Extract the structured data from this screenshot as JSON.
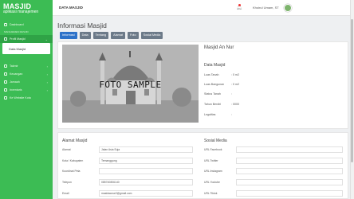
{
  "brand": {
    "logo_text": "MASJID",
    "subtitle": "aplikasi manajemen"
  },
  "sidebar": {
    "dashboard": "Dashboard",
    "section_label": "MANAJEMEN MASJID",
    "profil_label": "Profil Masjid",
    "sub_item": "Data Masjid",
    "items": [
      "Takmir",
      "Keuangan",
      "Jamaah",
      "Inventaris",
      "Ke Website Kota"
    ]
  },
  "topbar": {
    "title": "DATA MASJID",
    "username": "Khoirul Umam, ST"
  },
  "page": {
    "title": "Informasi Masjid"
  },
  "tabs": [
    "Informasi",
    "Data",
    "Tentang",
    "Alamat",
    "Foto",
    "Sosial Media"
  ],
  "photo": {
    "label": "FOTO SAMPLE"
  },
  "info": {
    "name": "Masjid An Nur",
    "section": "Data Masjid",
    "rows": [
      {
        "label": "Luas Tanah",
        "value": ": 0 m2"
      },
      {
        "label": "Luas Bangunan",
        "value": ": 0 m2"
      },
      {
        "label": "Status Tanah",
        "value": ":"
      },
      {
        "label": "Tahun Berdiri",
        "value": ": 0000"
      },
      {
        "label": "Legalitas",
        "value": ":"
      }
    ]
  },
  "address": {
    "title": "Alamat Masjid",
    "rows": [
      {
        "label": "Alamat",
        "value": "Jalan Asia Suja"
      },
      {
        "label": "Kota / Kabupaten",
        "value": "Temanggung"
      },
      {
        "label": "Koordinat Peta",
        "value": ""
      },
      {
        "label": "Telepon",
        "value": "085740806140"
      },
      {
        "label": "Email",
        "value": "masidaanur2@gmail.com"
      }
    ]
  },
  "social": {
    "title": "Sosial Media",
    "rows": [
      "URL Facebook",
      "URL Twitter",
      "URL Instagram",
      "URL Youtube",
      "URL Tiktok"
    ]
  },
  "colors": {
    "sidebar": "#3cbc54",
    "tab": "#6c7a89",
    "tab_active": "#2d72c9"
  }
}
